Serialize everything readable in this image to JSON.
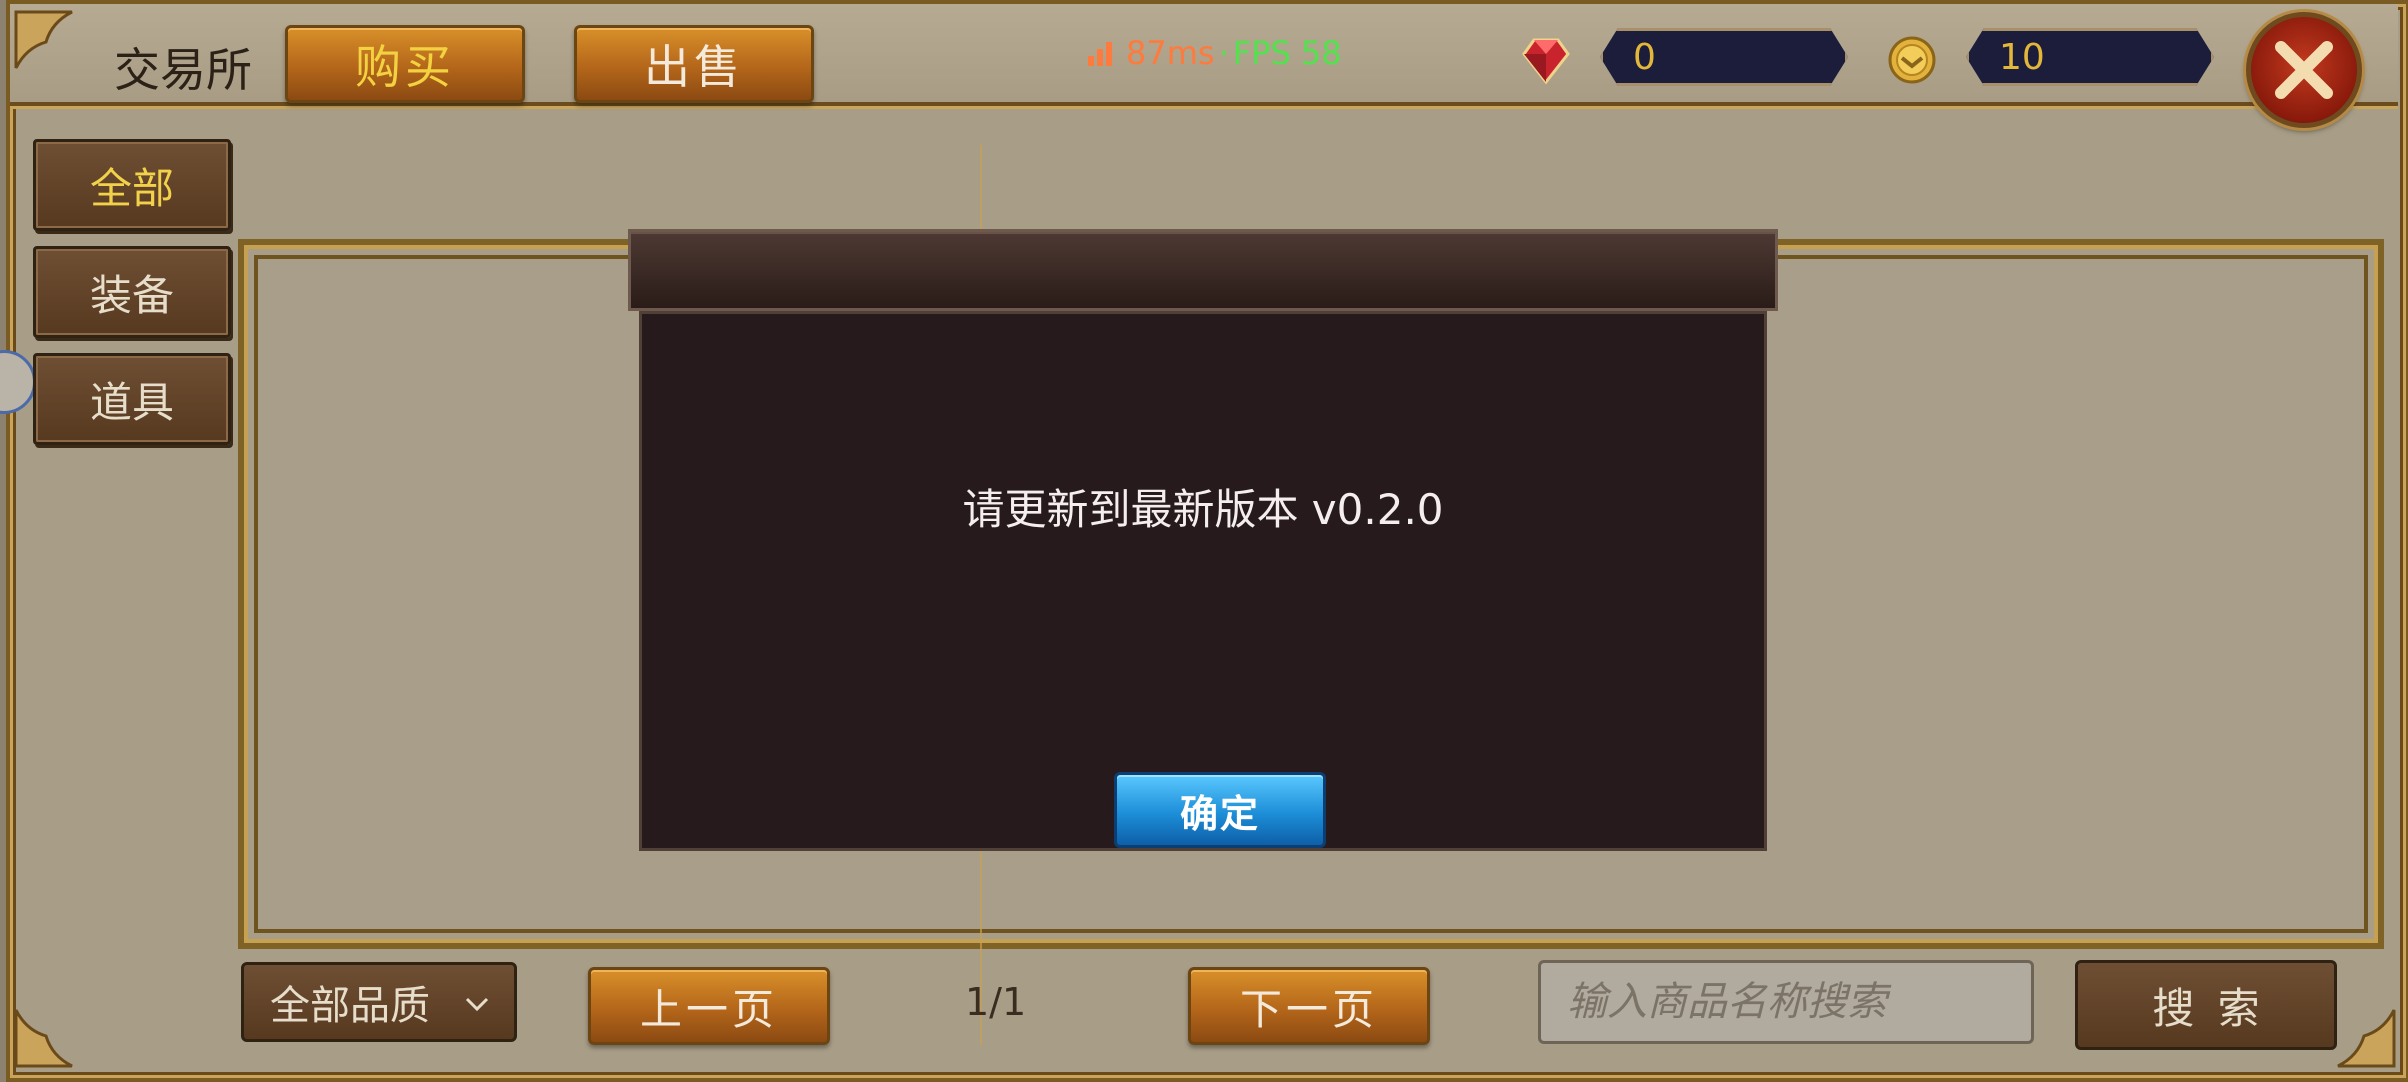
{
  "header": {
    "title": "交易所",
    "tabs": [
      {
        "label": "购买",
        "active": true
      },
      {
        "label": "出售",
        "active": false
      }
    ],
    "status": {
      "ping": "87ms",
      "separator": " · ",
      "fps": "FPS 58"
    },
    "currency": {
      "gem": {
        "icon": "ruby-gem-icon",
        "value": "0"
      },
      "coin": {
        "icon": "gold-coin-icon",
        "value": "10"
      }
    },
    "close_icon": "close-x-icon"
  },
  "sidebar": {
    "items": [
      {
        "label": "全部",
        "active": true
      },
      {
        "label": "装备",
        "active": false
      },
      {
        "label": "道具",
        "active": false
      }
    ]
  },
  "footer": {
    "quality_select": "全部品质",
    "prev_label": "上一页",
    "page_indicator": "1/1",
    "next_label": "下一页",
    "search_placeholder": "输入商品名称搜索",
    "search_label": "搜 索"
  },
  "dialog": {
    "message": "请更新到最新版本 v0.2.0",
    "confirm_label": "确定"
  },
  "colors": {
    "accent_gold": "#f2d240",
    "ping": "#ff7a3d",
    "fps": "#53e24d",
    "confirm_blue": "#1d8ed8"
  }
}
